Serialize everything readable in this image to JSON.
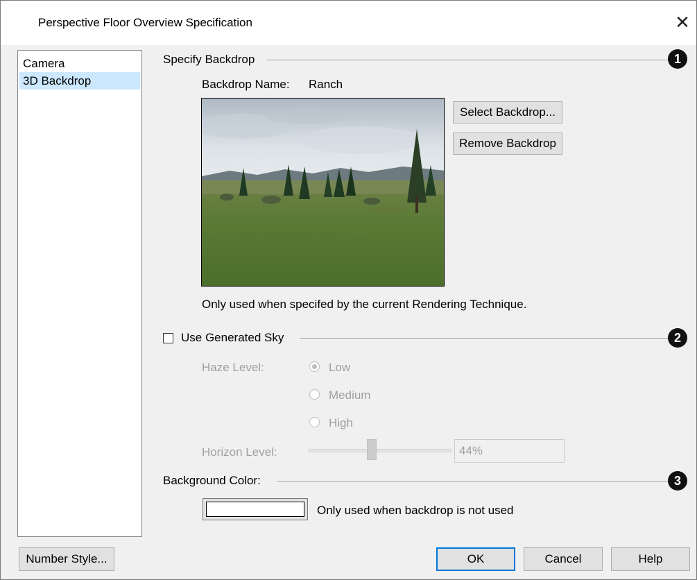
{
  "window": {
    "title": "Perspective Floor Overview Specification",
    "close_glyph": "✕"
  },
  "nav": {
    "items": [
      {
        "label": "Camera"
      },
      {
        "label": "3D Backdrop"
      }
    ]
  },
  "specify_backdrop": {
    "title": "Specify Backdrop",
    "badge": "1",
    "name_label": "Backdrop Name:",
    "name_value": "Ranch",
    "select_button": "Select Backdrop...",
    "remove_button": "Remove Backdrop",
    "note": "Only used when specifed by the current Rendering Technique."
  },
  "generated_sky": {
    "checkbox_label": "Use Generated Sky",
    "checked": false,
    "badge": "2",
    "haze_label": "Haze Level:",
    "haze_options": [
      {
        "label": "Low"
      },
      {
        "label": "Medium"
      },
      {
        "label": "High"
      }
    ],
    "haze_selected": "Low",
    "horizon_label": "Horizon Level:",
    "horizon_value": "44%"
  },
  "background_color": {
    "title": "Background Color:",
    "badge": "3",
    "swatch_color": "#ffffff",
    "note": "Only used when backdrop is not used"
  },
  "footer": {
    "number_style": "Number Style...",
    "ok": "OK",
    "cancel": "Cancel",
    "help": "Help"
  },
  "colors": {
    "selection": "#cce8ff",
    "default_button_border": "#0078d7",
    "disabled_text": "#a0a0a0"
  }
}
